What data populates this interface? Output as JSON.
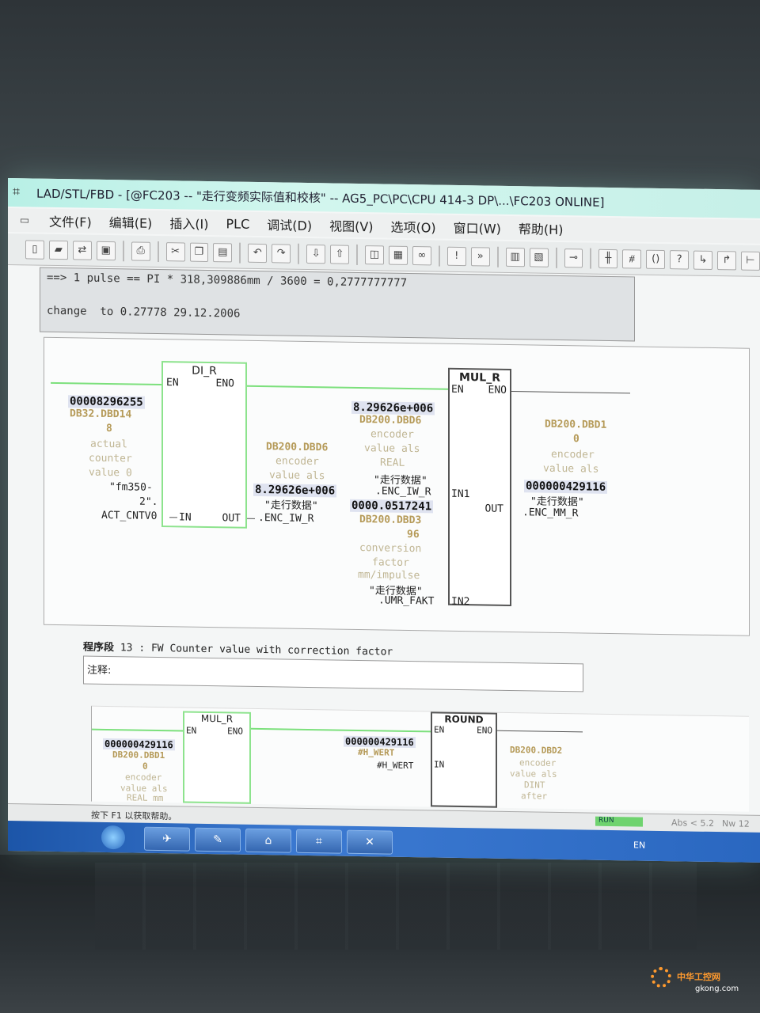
{
  "window": {
    "title": "LAD/STL/FBD  - [@FC203 -- \"走行变频实际值和校核\" -- AG5_PC\\PC\\CPU 414-3 DP\\...\\FC203  ONLINE]"
  },
  "menu": [
    "文件(F)",
    "编辑(E)",
    "插入(I)",
    "PLC",
    "调试(D)",
    "视图(V)",
    "选项(O)",
    "窗口(W)",
    "帮助(H)"
  ],
  "toolbar_icons": [
    "new-icon",
    "open-icon",
    "network-icon",
    "save-icon",
    "print-icon",
    "cut-icon",
    "copy-icon",
    "paste-icon",
    "undo-icon",
    "redo-icon",
    "download-icon",
    "upload-icon",
    "monitor-icon",
    "module-icon",
    "glasses-icon",
    "bookmark-icon",
    "overview-icon",
    "view-icon",
    "coil-icon",
    "contact-no-icon",
    "contact-nc-icon",
    "coil-open-icon",
    "box-icon",
    "branch-open-icon",
    "branch-close-icon",
    "connection-icon"
  ],
  "comment": {
    "line1": "==> 1 pulse == PI * 318,309886mm / 3600 = 0,2777777777",
    "line2": "change  to 0.27778 29.12.2006"
  },
  "network12": {
    "di_r": {
      "name": "DI_R",
      "en": "EN",
      "eno": "ENO",
      "in": "IN",
      "out": "OUT"
    },
    "in_value": "00008296255",
    "in_addr1": "DB32.DBD14",
    "in_addr2": "8",
    "in_cmt1": "actual",
    "in_cmt2": "counter",
    "in_cmt3": "value 0",
    "in_sym1": "\"fm350-",
    "in_sym2": "2\".",
    "in_sym3": "ACT_CNTV0",
    "out_addr": "DB200.DBD6",
    "out_cmt1": "encoder",
    "out_cmt2": "value als",
    "out_value": "8.29626e+006",
    "out_sym1": "\"走行数据\"",
    "out_sym2": ".ENC_IW_R",
    "mul_r": {
      "name": "MUL_R",
      "en": "EN",
      "eno": "ENO",
      "in1": "IN1",
      "in2": "IN2",
      "out": "OUT"
    },
    "in1_value": "8.29626e+006",
    "in1_addr": "DB200.DBD6",
    "in1_cmt1": "encoder",
    "in1_cmt2": "value als",
    "in1_cmt3": "REAL",
    "in1_sym1": "\"走行数据\"",
    "in1_sym2": ".ENC_IW_R",
    "in2_value": "0000.0517241",
    "in2_addr1": "DB200.DBD3",
    "in2_addr2": "96",
    "in2_cmt1": "conversion",
    "in2_cmt2": "factor",
    "in2_cmt3": "mm/impulse",
    "in2_sym1": "\"走行数据\"",
    "in2_sym2": ".UMR_FAKT",
    "mul_out_addr1": "DB200.DBD1",
    "mul_out_addr2": "0",
    "mul_out_cmt1": "encoder",
    "mul_out_cmt2": "value als",
    "mul_out_value": "000000429116",
    "mul_out_sym1": "\"走行数据\"",
    "mul_out_sym2": ".ENC_MM_R"
  },
  "segment13": {
    "label": "程序段",
    "number": "13",
    "title": ": FW Counter value with correction factor",
    "note_label": "注释:"
  },
  "network13": {
    "mul_r": {
      "name": "MUL_R",
      "en": "EN",
      "eno": "ENO"
    },
    "in_value": "000000429116",
    "in_addr1": "DB200.DBD1",
    "in_addr2": "0",
    "in_cmt1": "encoder",
    "in_cmt2": "value als",
    "in_cmt3": "REAL mm",
    "round": {
      "name": "ROUND",
      "en": "EN",
      "eno": "ENO",
      "in": "IN"
    },
    "hw_value": "000000429116",
    "hw_addr": "#H_WERT",
    "hw_sym": "#H_WERT",
    "round_out_addr": "DB200.DBD2",
    "round_out_cmt1": "encoder",
    "round_out_cmt2": "value als",
    "round_out_cmt3": "DINT",
    "round_out_cmt4": "after"
  },
  "status": {
    "help": "按下 F1 以获取帮助。",
    "run": "RUN",
    "abs": "Abs < 5.2",
    "nw": "Nw 12"
  },
  "tray": {
    "lang": "EN"
  },
  "watermark": {
    "text": "中华工控网",
    "url": "gkong.com"
  }
}
